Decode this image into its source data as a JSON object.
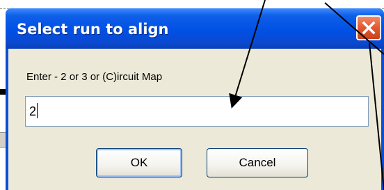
{
  "dialog": {
    "title": "Select run to align",
    "prompt": "Enter -  2 or 3 or  (C)ircuit Map",
    "input_value": "2",
    "ok_label": "OK",
    "cancel_label": "Cancel",
    "close_icon": "close-icon"
  },
  "colors": {
    "titlebar": "#0050e6",
    "client": "#ece9d8",
    "close_button": "#e2582f",
    "annotation_arrow": "#000000"
  }
}
